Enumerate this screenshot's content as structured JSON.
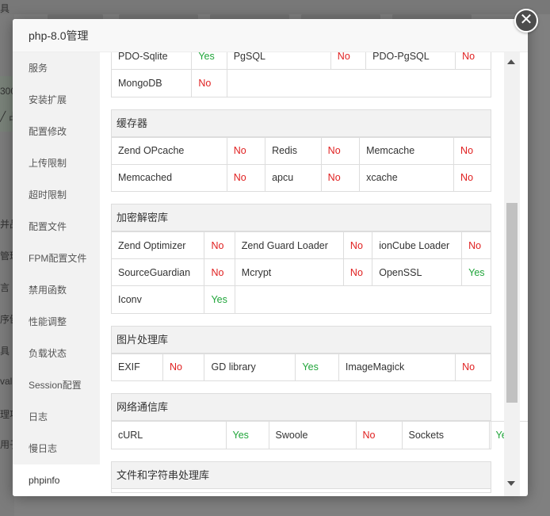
{
  "dialog": {
    "title": "php-8.0管理",
    "close_glyph": "✕"
  },
  "sidebar": {
    "items": [
      {
        "label": "服务"
      },
      {
        "label": "安装扩展"
      },
      {
        "label": "配置修改"
      },
      {
        "label": "上传限制"
      },
      {
        "label": "超时限制"
      },
      {
        "label": "配置文件"
      },
      {
        "label": "FPM配置文件"
      },
      {
        "label": "禁用函数"
      },
      {
        "label": "性能调整"
      },
      {
        "label": "负载状态"
      },
      {
        "label": "Session配置"
      },
      {
        "label": "日志"
      },
      {
        "label": "慢日志"
      },
      {
        "label": "phpinfo"
      }
    ],
    "active_index": 13
  },
  "background": {
    "topbar_label": "具",
    "side_fragments": [
      "300",
      "╱ 占",
      "并品",
      "管理",
      "言",
      "序健",
      "具",
      "valu",
      "理項",
      "用子"
    ]
  },
  "sections": [
    {
      "title": "",
      "rows": [
        [
          {
            "name": "PDO-Sqlite",
            "status": "Yes"
          },
          {
            "name": "PgSQL",
            "status": "No"
          },
          {
            "name": "PDO-PgSQL",
            "status": "No"
          }
        ],
        [
          {
            "name": "MongoDB",
            "status": "No"
          }
        ]
      ]
    },
    {
      "title": "缓存器",
      "rows": [
        [
          {
            "name": "Zend OPcache",
            "status": "No"
          },
          {
            "name": "Redis",
            "status": "No"
          },
          {
            "name": "Memcache",
            "status": "No"
          }
        ],
        [
          {
            "name": "Memcached",
            "status": "No"
          },
          {
            "name": "apcu",
            "status": "No"
          },
          {
            "name": "xcache",
            "status": "No"
          }
        ]
      ]
    },
    {
      "title": "加密解密库",
      "rows": [
        [
          {
            "name": "Zend Optimizer",
            "status": "No"
          },
          {
            "name": "Zend Guard Loader",
            "status": "No"
          },
          {
            "name": "ionCube Loader",
            "status": "No"
          }
        ],
        [
          {
            "name": "SourceGuardian",
            "status": "No"
          },
          {
            "name": "Mcrypt",
            "status": "No"
          },
          {
            "name": "OpenSSL",
            "status": "Yes"
          }
        ],
        [
          {
            "name": "Iconv",
            "status": "Yes"
          }
        ]
      ]
    },
    {
      "title": "图片处理库",
      "rows": [
        [
          {
            "name": "EXIF",
            "status": "No"
          },
          {
            "name": "GD library",
            "status": "Yes"
          },
          {
            "name": "ImageMagick",
            "status": "No"
          }
        ]
      ]
    },
    {
      "title": "网络通信库",
      "rows": [
        [
          {
            "name": "cURL",
            "status": "Yes"
          },
          {
            "name": "Swoole",
            "status": "No"
          },
          {
            "name": "Sockets",
            "status": "Yes"
          }
        ]
      ]
    },
    {
      "title": "文件和字符串处理库",
      "rows": []
    }
  ],
  "colors": {
    "yes": "#20a53a",
    "no": "#e02020",
    "sidebar_bg": "#f2f2f2",
    "section_header_bg": "#f2f2f2"
  }
}
